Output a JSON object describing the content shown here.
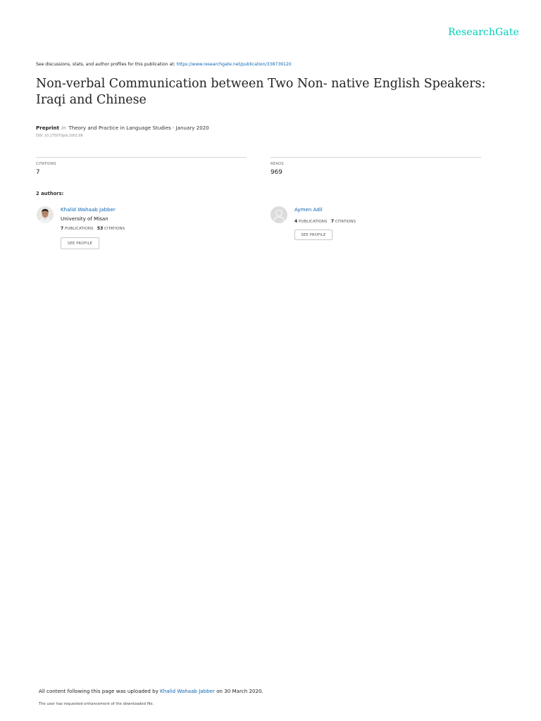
{
  "brand": {
    "name": "ResearchGate",
    "color": "#00ccbb"
  },
  "header": {
    "discuss_text": "See discussions, stats, and author profiles for this publication at:",
    "discuss_url": "https://www.researchgate.net/publication/338739120"
  },
  "publication": {
    "title": "Non-verbal Communication between Two Non- native English Speakers: Iraqi and Chinese",
    "type": "Preprint",
    "in_word": "in",
    "venue": "Theory and Practice in Language Studies · January 2020",
    "doi": "DOI: 10.17507/tpls.1002.06"
  },
  "stats": {
    "citations_label": "CITATIONS",
    "citations_value": "7",
    "reads_label": "READS",
    "reads_value": "969"
  },
  "authors_heading": "2 authors:",
  "authors": [
    {
      "name": "Khalid Wahaab Jabber",
      "affiliation": "University of Misan",
      "publications_count": "7",
      "publications_label": "PUBLICATIONS",
      "citations_count": "53",
      "citations_label": "CITATIONS",
      "button_label": "SEE PROFILE",
      "avatar_icon": "user-photo-icon"
    },
    {
      "name": "Aymen Adil",
      "publications_count": "4",
      "publications_label": "PUBLICATIONS",
      "citations_count": "7",
      "citations_label": "CITATIONS",
      "button_label": "SEE PROFILE",
      "avatar_icon": "default-avatar-icon"
    }
  ],
  "footer": {
    "uploaded_prefix": "All content following this page was uploaded by",
    "uploader": "Khalid Wahaab Jabber",
    "uploaded_suffix": "on 30 March 2020.",
    "requested_text": "The user has requested enhancement of the downloaded file."
  },
  "colors": {
    "link": "#0a65b5",
    "rule": "#d6d6d6"
  }
}
